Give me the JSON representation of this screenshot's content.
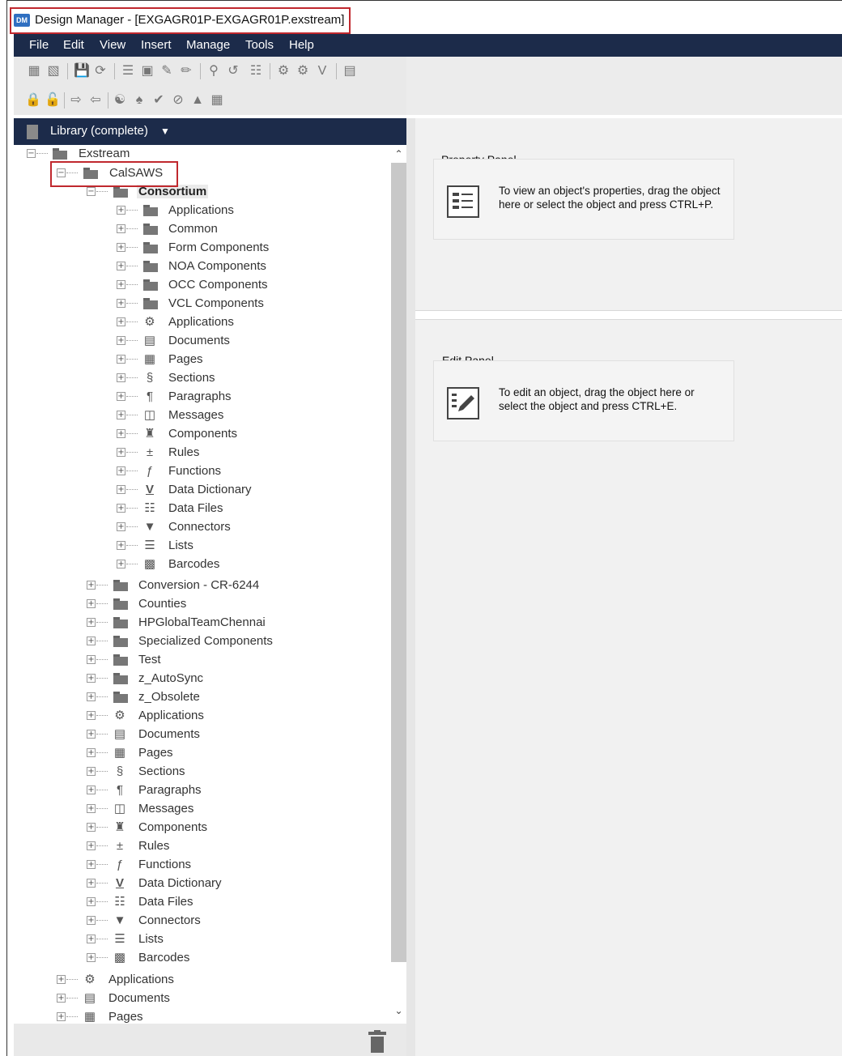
{
  "window": {
    "title": "Design Manager - [EXGAGR01P-EXGAGR01P.exstream]",
    "app_icon": "design-manager-icon"
  },
  "menu": {
    "items": [
      "File",
      "Edit",
      "View",
      "Insert",
      "Manage",
      "Tools",
      "Help"
    ]
  },
  "library": {
    "title": "Library (complete)"
  },
  "tree": {
    "root": "Exstream",
    "calsaws": "CalSAWS",
    "consortium": "Consortium",
    "consortium_children": [
      "Applications",
      "Common",
      "Form Components",
      "NOA Components",
      "OCC Components",
      "VCL Components",
      "Applications",
      "Documents",
      "Pages",
      "Sections",
      "Paragraphs",
      "Messages",
      "Components",
      "Rules",
      "Functions",
      "Data Dictionary",
      "Data Files",
      "Connectors",
      "Lists",
      "Barcodes"
    ],
    "calsaws_children": [
      "Conversion - CR-6244",
      "Counties",
      "HPGlobalTeamChennai",
      "Specialized Components",
      "Test",
      "z_AutoSync",
      "z_Obsolete",
      "Applications",
      "Documents",
      "Pages",
      "Sections",
      "Paragraphs",
      "Messages",
      "Components",
      "Rules",
      "Functions",
      "Data Dictionary",
      "Data Files",
      "Connectors",
      "Lists",
      "Barcodes"
    ],
    "root_children": [
      "Applications",
      "Documents",
      "Pages"
    ]
  },
  "property_panel": {
    "title": "Property Panel",
    "text": "To view an object's properties, drag the object here or select the object and press CTRL+P."
  },
  "edit_panel": {
    "title": "Edit Panel",
    "text": "To edit an object, drag the object here or select the object and press CTRL+E."
  }
}
